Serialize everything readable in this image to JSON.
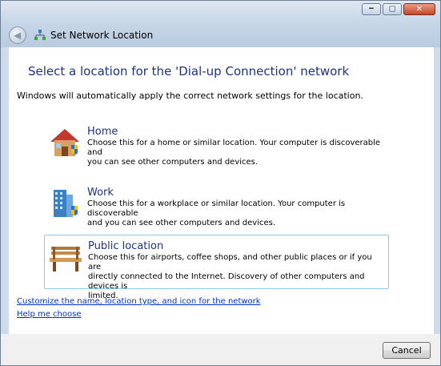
{
  "window": {
    "title": "Set Network Location",
    "controls": [
      "minimize",
      "maximize",
      "close"
    ]
  },
  "heading": "Select a location for the 'Dial-up Connection' network",
  "description": "Windows will automatically apply the correct network settings for the location.",
  "options": [
    {
      "icon": "house-icon",
      "title": "Home",
      "line1": "Choose this for a home or similar location. Your computer is discoverable and",
      "line2": "you can see other computers and devices.",
      "line3": ""
    },
    {
      "icon": "office-building-icon",
      "title": "Work",
      "line1": "Choose this for a workplace or similar location. Your computer is discoverable",
      "line2": "and you can see other computers and devices.",
      "line3": ""
    },
    {
      "icon": "park-bench-icon",
      "title": "Public location",
      "line1": "Choose this for airports, coffee shops, and other public places or if you are",
      "line2": "directly connected to the Internet. Discovery of other computers and devices is",
      "line3": "limited."
    }
  ],
  "links": {
    "customize": "Customize the name, location type, and icon for the network",
    "help": "Help me choose"
  },
  "buttons": {
    "cancel": "Cancel"
  },
  "colors": {
    "heading": "#1e3287",
    "link": "#0033cc",
    "selected_border": "#8ec8ea"
  }
}
